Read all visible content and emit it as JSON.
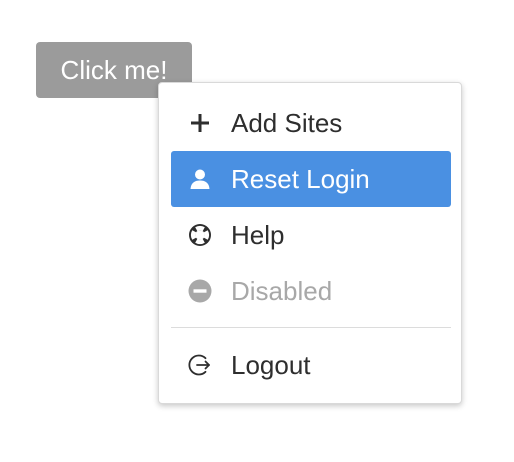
{
  "trigger": {
    "label": "Click me!"
  },
  "menu": {
    "items": [
      {
        "label": "Add Sites",
        "icon": "plus-icon",
        "state": "normal"
      },
      {
        "label": "Reset Login",
        "icon": "user-icon",
        "state": "highlighted"
      },
      {
        "label": "Help",
        "icon": "lifebuoy-icon",
        "state": "normal"
      },
      {
        "label": "Disabled",
        "icon": "minus-circle-icon",
        "state": "disabled"
      },
      {
        "label": "Logout",
        "icon": "logout-icon",
        "state": "normal"
      }
    ]
  },
  "colors": {
    "button_bg": "#9b9b9b",
    "highlight_bg": "#4a90e2",
    "text": "#2e2e2e",
    "disabled_text": "#a8a8a8"
  }
}
